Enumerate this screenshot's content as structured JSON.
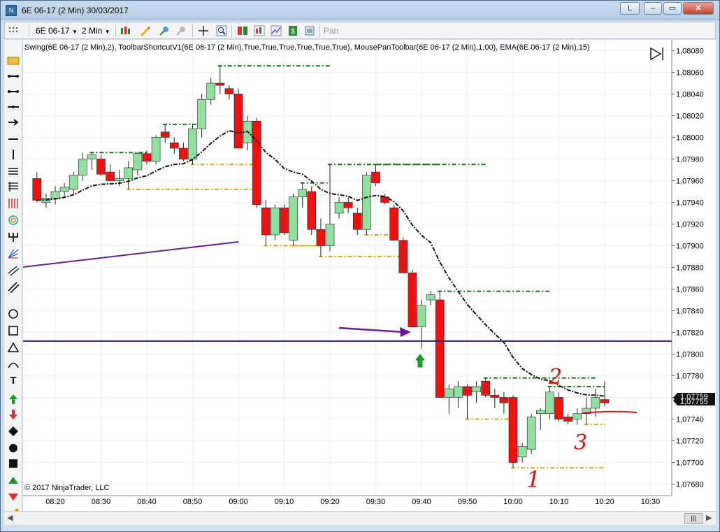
{
  "window": {
    "title": "6E 06-17 (2 Min)  30/03/2017",
    "buttons": {
      "l": "L",
      "minimize": "–",
      "maximize": "▭",
      "close": "✕"
    }
  },
  "toolbar": {
    "instrument": "6E 06-17",
    "interval": "2 Min",
    "pan_label": "Pan"
  },
  "chart": {
    "indicator_label": "Swing(6E 06-17 (2 Min),2), ToolbarShortcutV1(6E 06-17 (2 Min),True,True,True,True,True,True), MousePanToolbar(6E 06-17 (2 Min),1.00), EMA(6E 06-17 (2 Min),15)",
    "copyright": "© 2017 NinjaTrader, LLC",
    "current_price_labels": [
      "1,07759",
      "1,07755"
    ],
    "annotations": [
      "1",
      "2",
      "3"
    ],
    "colors": {
      "up": "#90e0a0",
      "down": "#ee1111",
      "swing_high": "#0a7a0a",
      "swing_low": "#e8a200",
      "ema": "#111111",
      "hline": "#2a1e8c",
      "trend": "#6a1b9a",
      "pen": "#dd1111"
    }
  },
  "chart_data": {
    "type": "candlestick",
    "y_ticks": [
      "1,08080",
      "1,08060",
      "1,08040",
      "1,08020",
      "1,08000",
      "1,07980",
      "1,07960",
      "1,07940",
      "1,07920",
      "1,07900",
      "1,07880",
      "1,07860",
      "1,07840",
      "1,07820",
      "1,07800",
      "1,07780",
      "1,07760",
      "1,07740",
      "1,07720",
      "1,07700",
      "1,07680"
    ],
    "x_ticks": [
      "08:20",
      "08:30",
      "08:40",
      "08:50",
      "09:00",
      "09:10",
      "09:20",
      "09:30",
      "09:40",
      "09:50",
      "10:00",
      "10:10",
      "10:20",
      "10:30"
    ],
    "horizontal_line": 1.07812,
    "candles": [
      {
        "t": "08:16",
        "o": 1.07962,
        "h": 1.07968,
        "l": 1.0794,
        "c": 1.07942
      },
      {
        "t": "08:18",
        "o": 1.0794,
        "h": 1.07948,
        "l": 1.07935,
        "c": 1.07944
      },
      {
        "t": "08:20",
        "o": 1.07944,
        "h": 1.07955,
        "l": 1.07938,
        "c": 1.0795
      },
      {
        "t": "08:22",
        "o": 1.0795,
        "h": 1.07958,
        "l": 1.07944,
        "c": 1.07954
      },
      {
        "t": "08:24",
        "o": 1.07952,
        "h": 1.07968,
        "l": 1.07948,
        "c": 1.07965
      },
      {
        "t": "08:26",
        "o": 1.07965,
        "h": 1.07986,
        "l": 1.0796,
        "c": 1.0798
      },
      {
        "t": "08:28",
        "o": 1.0798,
        "h": 1.07986,
        "l": 1.0797,
        "c": 1.07984
      },
      {
        "t": "08:30",
        "o": 1.0798,
        "h": 1.07984,
        "l": 1.07965,
        "c": 1.07966
      },
      {
        "t": "08:32",
        "o": 1.07968,
        "h": 1.07975,
        "l": 1.0796,
        "c": 1.0796
      },
      {
        "t": "08:34",
        "o": 1.0796,
        "h": 1.0797,
        "l": 1.07955,
        "c": 1.07962
      },
      {
        "t": "08:36",
        "o": 1.07962,
        "h": 1.07978,
        "l": 1.07952,
        "c": 1.07972
      },
      {
        "t": "08:38",
        "o": 1.0797,
        "h": 1.07986,
        "l": 1.07965,
        "c": 1.07985
      },
      {
        "t": "08:40",
        "o": 1.07985,
        "h": 1.07988,
        "l": 1.07975,
        "c": 1.07978
      },
      {
        "t": "08:42",
        "o": 1.07978,
        "h": 1.08002,
        "l": 1.07975,
        "c": 1.08
      },
      {
        "t": "08:44",
        "o": 1.08005,
        "h": 1.08012,
        "l": 1.07995,
        "c": 1.08
      },
      {
        "t": "08:46",
        "o": 1.07995,
        "h": 1.08,
        "l": 1.07985,
        "c": 1.0799
      },
      {
        "t": "08:48",
        "o": 1.0799,
        "h": 1.07995,
        "l": 1.07978,
        "c": 1.0798
      },
      {
        "t": "08:50",
        "o": 1.0798,
        "h": 1.08012,
        "l": 1.07975,
        "c": 1.08008
      },
      {
        "t": "08:52",
        "o": 1.08008,
        "h": 1.0804,
        "l": 1.08,
        "c": 1.08035
      },
      {
        "t": "08:54",
        "o": 1.08035,
        "h": 1.08055,
        "l": 1.0803,
        "c": 1.0805
      },
      {
        "t": "08:56",
        "o": 1.0805,
        "h": 1.08066,
        "l": 1.0804,
        "c": 1.08048
      },
      {
        "t": "08:58",
        "o": 1.08045,
        "h": 1.08048,
        "l": 1.08035,
        "c": 1.0804
      },
      {
        "t": "09:00",
        "o": 1.0804,
        "h": 1.08045,
        "l": 1.0799,
        "c": 1.0799
      },
      {
        "t": "09:02",
        "o": 1.07995,
        "h": 1.0802,
        "l": 1.07988,
        "c": 1.08015
      },
      {
        "t": "09:04",
        "o": 1.08015,
        "h": 1.08018,
        "l": 1.07935,
        "c": 1.07938
      },
      {
        "t": "09:06",
        "o": 1.07935,
        "h": 1.07942,
        "l": 1.079,
        "c": 1.0791
      },
      {
        "t": "09:08",
        "o": 1.0791,
        "h": 1.07938,
        "l": 1.07905,
        "c": 1.07935
      },
      {
        "t": "09:10",
        "o": 1.07935,
        "h": 1.07938,
        "l": 1.0791,
        "c": 1.07912
      },
      {
        "t": "09:12",
        "o": 1.07905,
        "h": 1.07948,
        "l": 1.079,
        "c": 1.07945
      },
      {
        "t": "09:14",
        "o": 1.07945,
        "h": 1.07958,
        "l": 1.07935,
        "c": 1.07952
      },
      {
        "t": "09:16",
        "o": 1.0795,
        "h": 1.07955,
        "l": 1.0791,
        "c": 1.07915
      },
      {
        "t": "09:18",
        "o": 1.07915,
        "h": 1.07925,
        "l": 1.0789,
        "c": 1.079
      },
      {
        "t": "09:20",
        "o": 1.079,
        "h": 1.07975,
        "l": 1.07895,
        "c": 1.0792
      },
      {
        "t": "09:22",
        "o": 1.0793,
        "h": 1.07945,
        "l": 1.07925,
        "c": 1.0794
      },
      {
        "t": "09:24",
        "o": 1.0794,
        "h": 1.07945,
        "l": 1.0793,
        "c": 1.07935
      },
      {
        "t": "09:26",
        "o": 1.0793,
        "h": 1.07935,
        "l": 1.0791,
        "c": 1.07915
      },
      {
        "t": "09:28",
        "o": 1.07915,
        "h": 1.07968,
        "l": 1.0791,
        "c": 1.07965
      },
      {
        "t": "09:30",
        "o": 1.07968,
        "h": 1.07975,
        "l": 1.07955,
        "c": 1.07958
      },
      {
        "t": "09:32",
        "o": 1.07945,
        "h": 1.07948,
        "l": 1.07938,
        "c": 1.0794
      },
      {
        "t": "09:34",
        "o": 1.07935,
        "h": 1.07938,
        "l": 1.07905,
        "c": 1.07905
      },
      {
        "t": "09:36",
        "o": 1.07905,
        "h": 1.07908,
        "l": 1.07875,
        "c": 1.07875
      },
      {
        "t": "09:38",
        "o": 1.07875,
        "h": 1.07878,
        "l": 1.07825,
        "c": 1.07825
      },
      {
        "t": "09:40",
        "o": 1.07825,
        "h": 1.0785,
        "l": 1.07805,
        "c": 1.07845
      },
      {
        "t": "09:42",
        "o": 1.0785,
        "h": 1.07858,
        "l": 1.07845,
        "c": 1.07855
      },
      {
        "t": "09:44",
        "o": 1.0785,
        "h": 1.07858,
        "l": 1.0776,
        "c": 1.0776
      },
      {
        "t": "09:46",
        "o": 1.0776,
        "h": 1.07772,
        "l": 1.07745,
        "c": 1.07768
      },
      {
        "t": "09:48",
        "o": 1.0776,
        "h": 1.07775,
        "l": 1.0775,
        "c": 1.0777
      },
      {
        "t": "09:50",
        "o": 1.0777,
        "h": 1.07772,
        "l": 1.0774,
        "c": 1.07762
      },
      {
        "t": "09:52",
        "o": 1.07765,
        "h": 1.07775,
        "l": 1.07755,
        "c": 1.0777
      },
      {
        "t": "09:54",
        "o": 1.07775,
        "h": 1.07778,
        "l": 1.0776,
        "c": 1.07762
      },
      {
        "t": "09:56",
        "o": 1.07762,
        "h": 1.07768,
        "l": 1.0775,
        "c": 1.0776
      },
      {
        "t": "09:58",
        "o": 1.0776,
        "h": 1.07765,
        "l": 1.07745,
        "c": 1.07755
      },
      {
        "t": "10:00",
        "o": 1.0776,
        "h": 1.07762,
        "l": 1.07695,
        "c": 1.077
      },
      {
        "t": "10:02",
        "o": 1.07705,
        "h": 1.07718,
        "l": 1.077,
        "c": 1.07715
      },
      {
        "t": "10:04",
        "o": 1.07712,
        "h": 1.07745,
        "l": 1.07708,
        "c": 1.07742
      },
      {
        "t": "10:06",
        "o": 1.07745,
        "h": 1.0775,
        "l": 1.0773,
        "c": 1.07748
      },
      {
        "t": "10:08",
        "o": 1.07745,
        "h": 1.0777,
        "l": 1.0774,
        "c": 1.07765
      },
      {
        "t": "10:10",
        "o": 1.0776,
        "h": 1.07765,
        "l": 1.07738,
        "c": 1.0774
      },
      {
        "t": "10:12",
        "o": 1.07742,
        "h": 1.07745,
        "l": 1.07735,
        "c": 1.07738
      },
      {
        "t": "10:14",
        "o": 1.0774,
        "h": 1.0775,
        "l": 1.07735,
        "c": 1.07745
      },
      {
        "t": "10:16",
        "o": 1.07745,
        "h": 1.0776,
        "l": 1.07735,
        "c": 1.0775
      },
      {
        "t": "10:18",
        "o": 1.0775,
        "h": 1.07768,
        "l": 1.07742,
        "c": 1.0776
      },
      {
        "t": "10:20",
        "o": 1.07758,
        "h": 1.07775,
        "l": 1.07752,
        "c": 1.07755
      }
    ]
  }
}
